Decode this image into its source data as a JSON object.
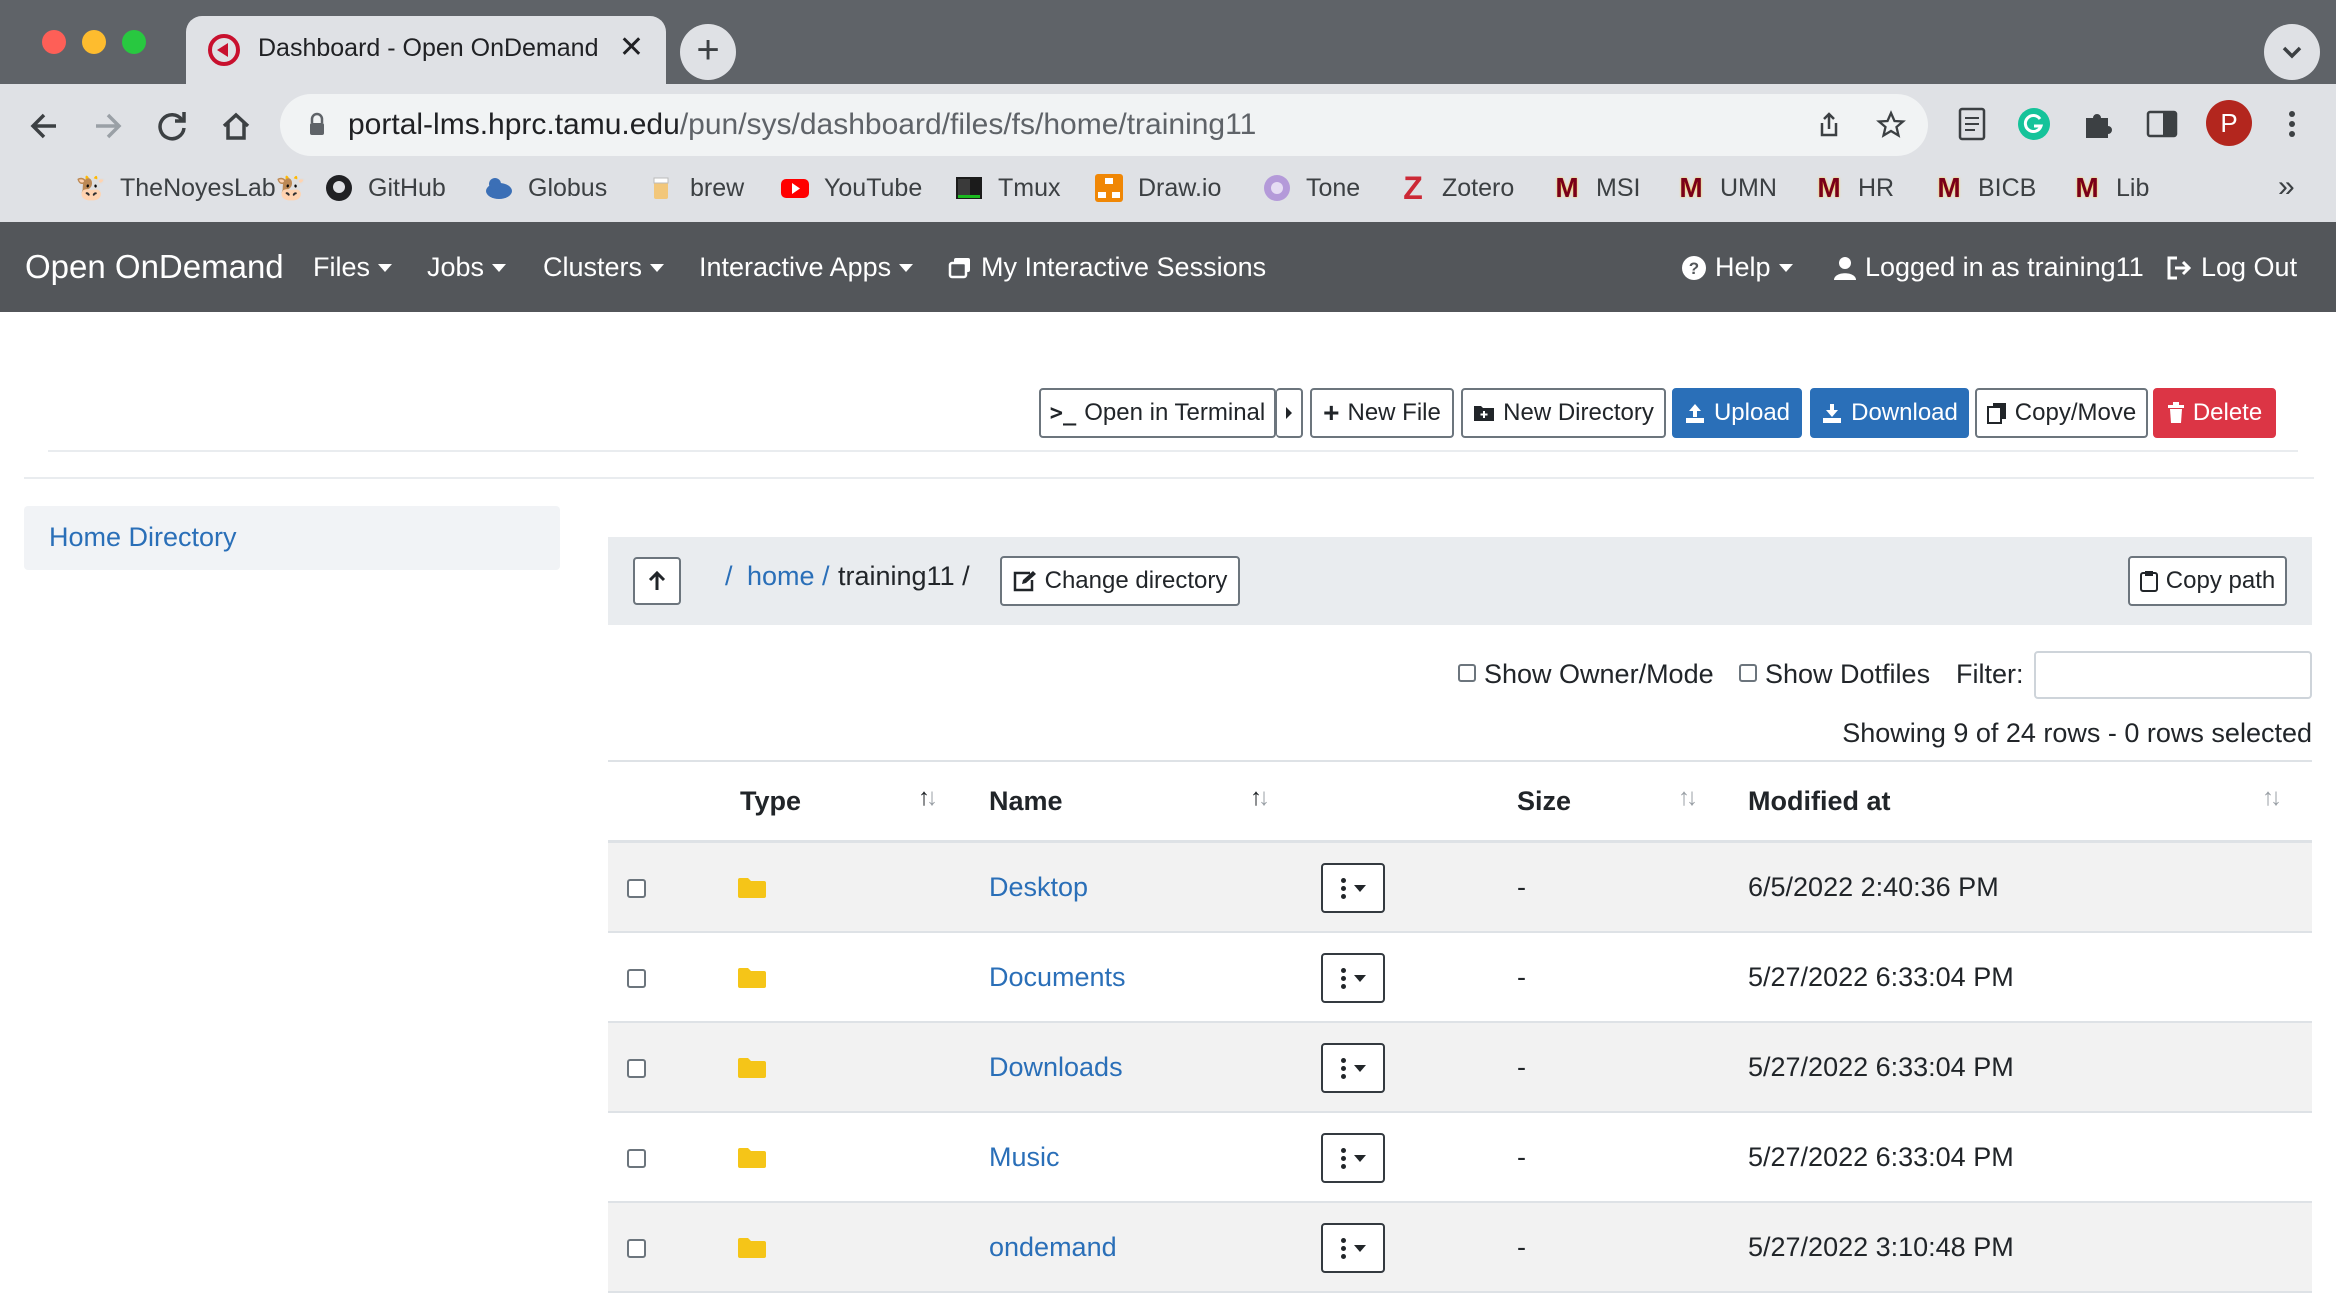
{
  "browser": {
    "tab_title": "Dashboard - Open OnDemand",
    "url_host": "portal-lms.hprc.tamu.edu",
    "url_path": "/pun/sys/dashboard/files/fs/home/training11",
    "profile_initial": "P",
    "bookmarks": [
      {
        "label": "TheNoyesLab🐮",
        "icon": "cow-icon"
      },
      {
        "label": "GitHub",
        "icon": "github-icon"
      },
      {
        "label": "Globus",
        "icon": "globus-icon"
      },
      {
        "label": "brew",
        "icon": "brew-icon"
      },
      {
        "label": "YouTube",
        "icon": "youtube-icon"
      },
      {
        "label": "Tmux",
        "icon": "tmux-icon"
      },
      {
        "label": "Draw.io",
        "icon": "drawio-icon"
      },
      {
        "label": "Tone",
        "icon": "tone-icon"
      },
      {
        "label": "Zotero",
        "icon": "zotero-icon"
      },
      {
        "label": "MSI",
        "icon": "umn-icon"
      },
      {
        "label": "UMN",
        "icon": "umn-icon"
      },
      {
        "label": "HR",
        "icon": "umn-icon"
      },
      {
        "label": "BICB",
        "icon": "umn-icon"
      },
      {
        "label": "Lib",
        "icon": "umn-icon"
      }
    ],
    "bookmarks_overflow": "»"
  },
  "navbar": {
    "brand": "Open OnDemand",
    "files": "Files",
    "jobs": "Jobs",
    "clusters": "Clusters",
    "interactive_apps": "Interactive Apps",
    "sessions": "My Interactive Sessions",
    "help": "Help",
    "user": "Logged in as training11",
    "logout": "Log Out"
  },
  "actions": {
    "open_terminal": "Open in Terminal",
    "new_file": "New File",
    "new_directory": "New Directory",
    "upload": "Upload",
    "download": "Download",
    "copy_move": "Copy/Move",
    "delete": "Delete"
  },
  "sidebar": {
    "home": "Home Directory"
  },
  "path": {
    "root_sep": "/",
    "home": "home /",
    "current": "training11 /",
    "change_directory": "Change directory",
    "copy_path": "Copy path"
  },
  "filters": {
    "show_owner": "Show Owner/Mode",
    "show_dotfiles": "Show Dotfiles",
    "filter_label": "Filter:",
    "filter_value": "",
    "summary": "Showing 9 of 24 rows - 0 rows selected"
  },
  "table": {
    "columns": {
      "type": "Type",
      "name": "Name",
      "size": "Size",
      "modified": "Modified at"
    },
    "rows": [
      {
        "name": "Desktop",
        "size": "-",
        "modified": "6/5/2022 2:40:36 PM"
      },
      {
        "name": "Documents",
        "size": "-",
        "modified": "5/27/2022 6:33:04 PM"
      },
      {
        "name": "Downloads",
        "size": "-",
        "modified": "5/27/2022 6:33:04 PM"
      },
      {
        "name": "Music",
        "size": "-",
        "modified": "5/27/2022 6:33:04 PM"
      },
      {
        "name": "ondemand",
        "size": "-",
        "modified": "5/27/2022 3:10:48 PM"
      }
    ]
  },
  "colors": {
    "navbar": "#53565a",
    "link": "#2a6fb8",
    "danger": "#dc3545",
    "folder": "#f5c518"
  }
}
